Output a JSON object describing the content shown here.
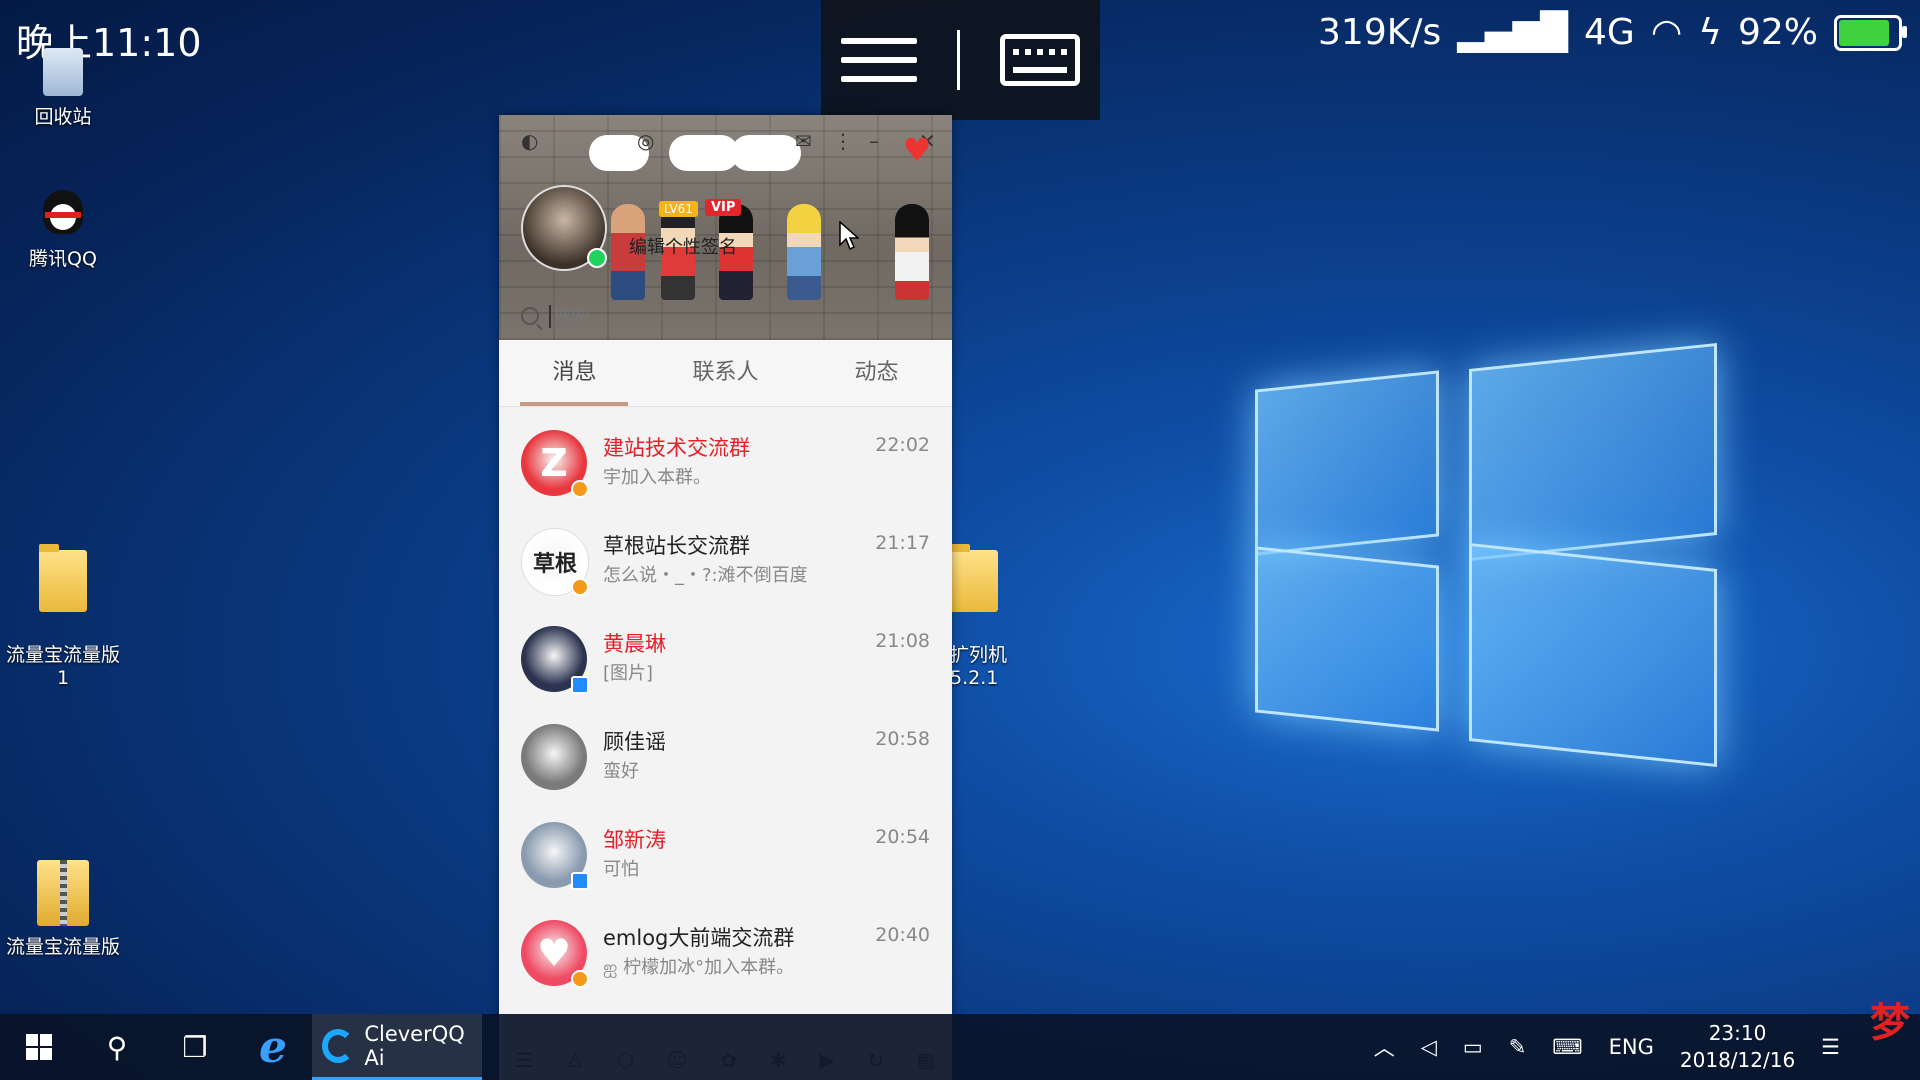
{
  "status_bar": {
    "time": "晚上11:10",
    "speed": "319K/s",
    "network": "4G",
    "battery": "92%",
    "battery_level": 0.92
  },
  "desktop_icons": [
    {
      "label": "回收站",
      "icon": "recycle-bin-icon"
    },
    {
      "label": "腾讯QQ",
      "icon": "qq-penguin-icon"
    },
    {
      "label": "流量宝流量版\n1",
      "icon": "folder-icon"
    },
    {
      "label": "流量宝流量版",
      "icon": "zip-folder-icon"
    },
    {
      "label": "扩列机\n5.2.1",
      "icon": "folder-icon"
    }
  ],
  "qq": {
    "level_badge": "LV61",
    "vip_badge": "VIP",
    "signature": "编辑个性签名",
    "search_placeholder": "搜索",
    "tabs": [
      "消息",
      "联系人",
      "动态"
    ],
    "messages": [
      {
        "name": "建站技术交流群",
        "preview": "宇加入本群。",
        "time": "22:02",
        "highlight": true,
        "avatar_color": "#e8373e",
        "avatar_text": "Z"
      },
      {
        "name": "草根站长交流群",
        "preview": "怎么说・_・?:滩不倒百度",
        "time": "21:17",
        "highlight": false,
        "avatar_color": "#ffffff",
        "avatar_text": "草根"
      },
      {
        "name": "黄晨琳",
        "preview": "[图片]",
        "time": "21:08",
        "highlight": true,
        "avatar_color": "#2b3350",
        "avatar_text": ""
      },
      {
        "name": "顾佳谣",
        "preview": "蛮好",
        "time": "20:58",
        "highlight": false,
        "avatar_color": "#7a7a7a",
        "avatar_text": ""
      },
      {
        "name": "邹新涛",
        "preview": "可怕",
        "time": "20:54",
        "highlight": true,
        "avatar_color": "#8a9bb0",
        "avatar_text": ""
      },
      {
        "name": "emlog大前端交流群",
        "preview": "ஐ 柠檬加冰°加入本群。",
        "time": "20:40",
        "highlight": false,
        "avatar_color": "#ef4a63",
        "avatar_text": "♥"
      }
    ]
  },
  "taskbar": {
    "app_label": "CleverQQ Ai",
    "lang": "ENG",
    "clock_time": "23:10",
    "clock_date": "2018/12/16"
  },
  "colors": {
    "accent_red": "#e6202a",
    "tab_underline": "#c59a84"
  }
}
